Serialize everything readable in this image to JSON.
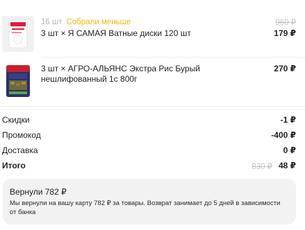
{
  "items": [
    {
      "quantity_badge": "16 шт",
      "status": "Собрали меньше",
      "title": "3 шт × Я САМАЯ Ватные диски 120 шт",
      "old_price": "960 ₽",
      "price": "179 ₽",
      "thumb_icon": "cotton-pads-package-icon"
    },
    {
      "title": "3 шт × АГРО-АЛЬЯНС Экстра Рис Бурый нешлифованный 1с 800г",
      "price": "270 ₽",
      "thumb_icon": "rice-package-icon"
    }
  ],
  "summary": {
    "discount_label": "Скидки",
    "discount_value": "-1 ₽",
    "promo_label": "Промокод",
    "promo_value": "-400 ₽",
    "delivery_label": "Доставка",
    "delivery_value": "0 ₽",
    "total_label": "Итого",
    "total_old": "830 ₽",
    "total_value": "48 ₽"
  },
  "refund": {
    "title": "Вернули 782 ₽",
    "text": "Мы вернули на вашу карту 782 ₽ за товары. Возврат занимает до 5 дней в зависимости от банка"
  },
  "colors": {
    "status_yellow": "#f2b705",
    "muted_gray": "#c4c4c4",
    "card_bg": "#f2f2f2"
  }
}
